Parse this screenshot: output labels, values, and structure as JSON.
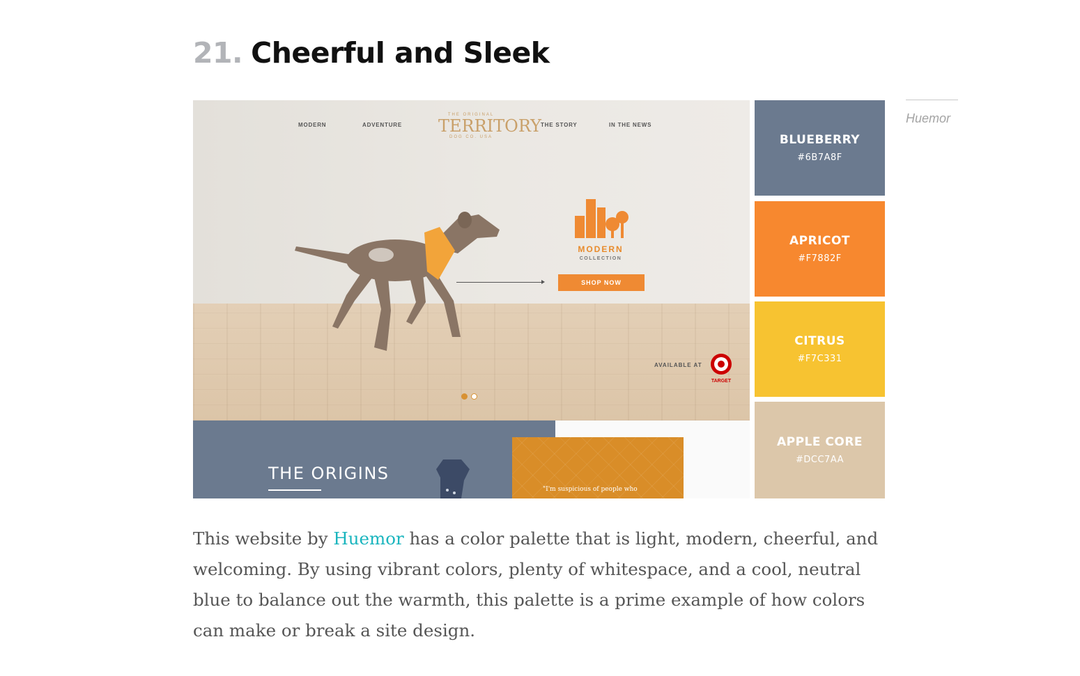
{
  "heading": {
    "number": "21.",
    "title": "Cheerful and Sleek"
  },
  "credit": "Huemor",
  "screenshot": {
    "nav": {
      "modern": "MODERN",
      "adventure": "ADVENTURE",
      "story": "THE STORY",
      "news": "IN THE NEWS"
    },
    "logo": {
      "top": "THE ORIGINAL",
      "main": "TERRITORY",
      "bottom": "DOG CO. USA"
    },
    "promo": {
      "title": "MODERN",
      "subtitle": "COLLECTION",
      "button": "SHOP NOW"
    },
    "available_at": "AVAILABLE AT",
    "target_label": "TARGET",
    "section_title": "THE ORIGINS",
    "quote": "\"I'm suspicious of people who"
  },
  "palette": [
    {
      "name": "BLUEBERRY",
      "hex": "#6B7A8F",
      "color": "#6b7a8f"
    },
    {
      "name": "APRICOT",
      "hex": "#F7882F",
      "color": "#f7882f"
    },
    {
      "name": "CITRUS",
      "hex": "#F7C331",
      "color": "#f7c331"
    },
    {
      "name": "APPLE CORE",
      "hex": "#DCC7AA",
      "color": "#dcc7aa"
    }
  ],
  "description": {
    "before_link": "This website by ",
    "link_text": "Huemor",
    "after_link": " has a color palette that is light, modern, cheerful, and welcoming. By using vibrant colors, plenty of whitespace, and a cool, neutral blue to balance out the warmth, this palette is a prime example of how colors can make or break a site design."
  }
}
